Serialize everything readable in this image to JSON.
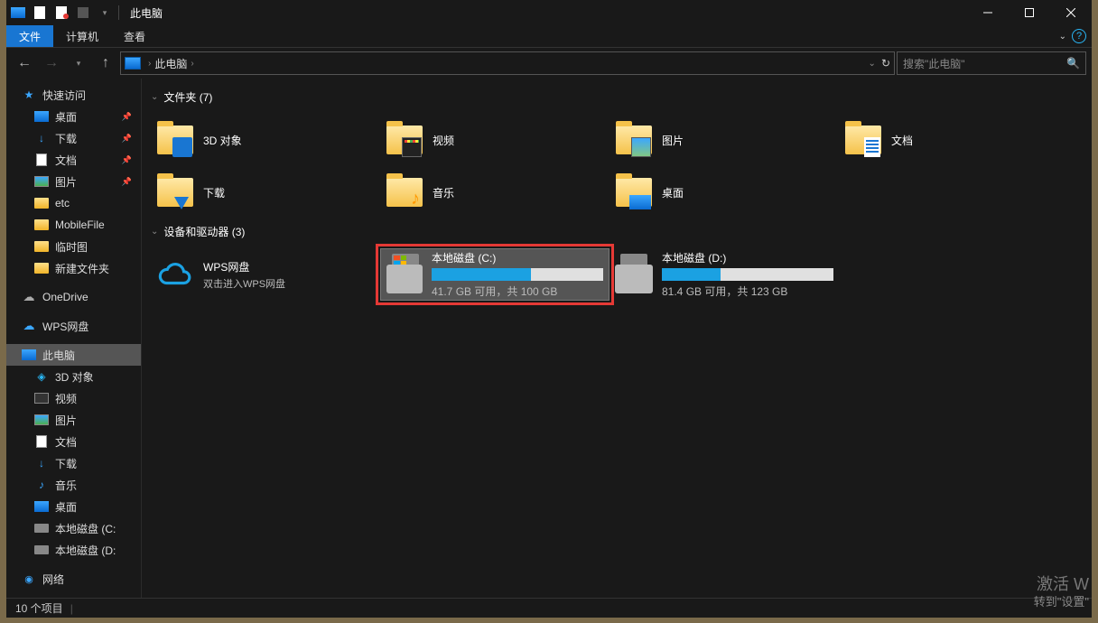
{
  "title": "此电脑",
  "ribbon": {
    "file": "文件",
    "computer": "计算机",
    "view": "查看"
  },
  "breadcrumb": {
    "root": "此电脑"
  },
  "search": {
    "placeholder": "搜索\"此电脑\""
  },
  "nav": {
    "quick_access": "快速访问",
    "desktop": "桌面",
    "downloads": "下载",
    "documents": "文档",
    "pictures": "图片",
    "etc": "etc",
    "mobilefile": "MobileFile",
    "tempimg": "临时图",
    "newfolder": "新建文件夹",
    "onedrive": "OneDrive",
    "wps": "WPS网盘",
    "thispc": "此电脑",
    "obj3d": "3D 对象",
    "videos": "视频",
    "pictures2": "图片",
    "documents2": "文档",
    "downloads2": "下载",
    "music": "音乐",
    "desktop2": "桌面",
    "drivec": "本地磁盘 (C:",
    "drived": "本地磁盘 (D:",
    "network": "网络"
  },
  "groups": {
    "folders": "文件夹 (7)",
    "drives": "设备和驱动器 (3)"
  },
  "folders": {
    "obj3d": "3D 对象",
    "videos": "视频",
    "pictures": "图片",
    "documents": "文档",
    "downloads": "下载",
    "music": "音乐",
    "desktop": "桌面"
  },
  "wps": {
    "name": "WPS网盘",
    "desc": "双击进入WPS网盘"
  },
  "drives": {
    "c": {
      "name": "本地磁盘 (C:)",
      "detail": "41.7 GB 可用，共 100 GB",
      "fill_pct": 58
    },
    "d": {
      "name": "本地磁盘 (D:)",
      "detail": "81.4 GB 可用，共 123 GB",
      "fill_pct": 34
    }
  },
  "status": {
    "count": "10 个项目"
  },
  "watermark": {
    "l1": "激活 W",
    "l2": "转到\"设置\""
  }
}
